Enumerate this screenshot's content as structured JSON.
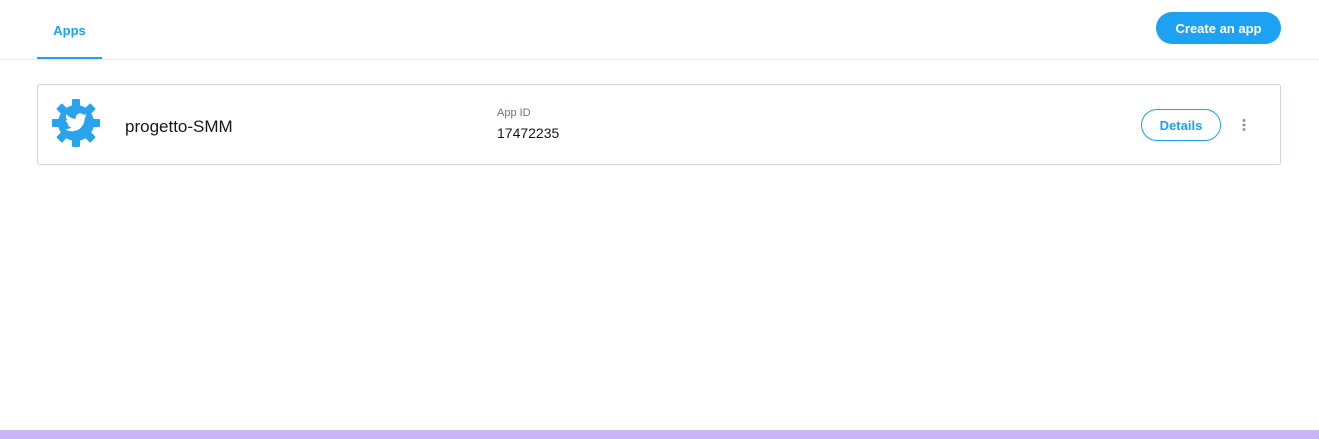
{
  "header": {
    "tabs": [
      {
        "label": "Apps",
        "active": true
      }
    ],
    "create_button_label": "Create an app"
  },
  "apps": [
    {
      "name": "progetto-SMM",
      "icon": "twitter-gear-icon",
      "app_id_label": "App ID",
      "app_id_value": "17472235",
      "details_label": "Details",
      "more_icon": "vertical-ellipsis-icon"
    }
  ],
  "colors": {
    "accent": "#1da1f2",
    "border": "#ccd6dd",
    "bottom_bar": "#c9b4f5"
  }
}
